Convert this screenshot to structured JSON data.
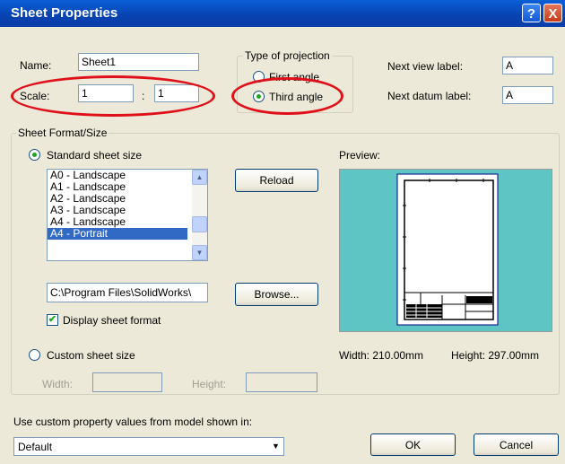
{
  "window": {
    "title": "Sheet Properties",
    "help_label": "?",
    "close_label": "X"
  },
  "name": {
    "label": "Name:",
    "value": "Sheet1"
  },
  "scale": {
    "label": "Scale:",
    "left": "1",
    "separator": ":",
    "right": "1"
  },
  "projection": {
    "title": "Type of projection",
    "first_angle": "First angle",
    "third_angle": "Third angle",
    "selected": "third_angle"
  },
  "next_view": {
    "label": "Next view label:",
    "value": "A"
  },
  "next_datum": {
    "label": "Next datum label:",
    "value": "A"
  },
  "sheet_format": {
    "title": "Sheet Format/Size",
    "standard_label": "Standard sheet size",
    "sizes": [
      "A0 - Landscape",
      "A1 - Landscape",
      "A2 - Landscape",
      "A3 - Landscape",
      "A4 - Landscape",
      "A4 - Portrait"
    ],
    "selected_index": 5,
    "reload_label": "Reload",
    "path": "C:\\Program Files\\SolidWorks\\",
    "browse_label": "Browse...",
    "display_format_label": "Display sheet format",
    "display_format_checked": true,
    "custom_label": "Custom sheet size",
    "width_label": "Width:",
    "height_label": "Height:"
  },
  "preview": {
    "label": "Preview:",
    "width_text": "Width:  210.00mm",
    "height_text": "Height:  297.00mm"
  },
  "bottom": {
    "custom_property_label": "Use custom property values from model shown in:",
    "model_value": "Default",
    "ok_label": "OK",
    "cancel_label": "Cancel"
  },
  "colors": {
    "annotation_red": "#e0101a",
    "preview_bg": "#5ec4c4",
    "selection": "#316ac5"
  }
}
